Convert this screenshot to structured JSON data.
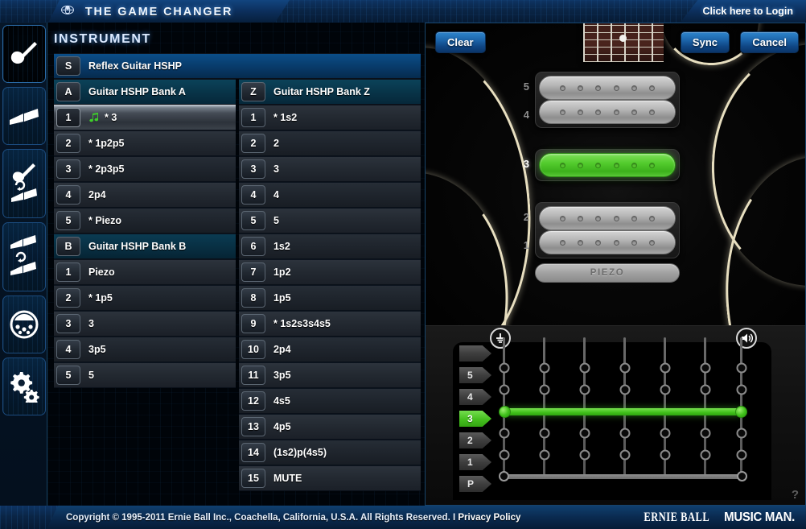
{
  "app": {
    "brand_title": "THE GAME CHANGER",
    "logo_icon": "ernie-ball-emblem-icon",
    "login_label": "Click here to Login"
  },
  "sidebar": {
    "items": [
      {
        "name": "instrument",
        "icon": "guitar-icon",
        "active": true
      },
      {
        "name": "library",
        "icon": "open-book-icon",
        "active": false
      },
      {
        "name": "guitar-to-library-sync",
        "icon": "guitar-book-sync-icon",
        "active": false
      },
      {
        "name": "library-to-library-sync",
        "icon": "book-book-sync-icon",
        "active": false
      },
      {
        "name": "midi-device",
        "icon": "midi-port-icon",
        "active": false
      },
      {
        "name": "settings",
        "icon": "gears-icon",
        "active": false
      }
    ]
  },
  "instrument_panel": {
    "title": "INSTRUMENT",
    "set_row": {
      "key": "S",
      "label": "Reflex Guitar HSHP"
    },
    "bank_a": {
      "key": "A",
      "header": "Guitar HSHP Bank A",
      "rows": [
        {
          "num": "1",
          "label": "* 3",
          "icon": "music-note-icon",
          "selected": true
        },
        {
          "num": "2",
          "label": "* 1p2p5",
          "selected": false
        },
        {
          "num": "3",
          "label": "* 2p3p5",
          "selected": false
        },
        {
          "num": "4",
          "label": "2p4",
          "selected": false
        },
        {
          "num": "5",
          "label": "* Piezo",
          "selected": false
        }
      ]
    },
    "bank_b": {
      "key": "B",
      "header": "Guitar HSHP Bank B",
      "rows": [
        {
          "num": "1",
          "label": "Piezo",
          "selected": false
        },
        {
          "num": "2",
          "label": "* 1p5",
          "selected": false
        },
        {
          "num": "3",
          "label": "3",
          "selected": false
        },
        {
          "num": "4",
          "label": "3p5",
          "selected": false
        },
        {
          "num": "5",
          "label": "5",
          "selected": false
        }
      ]
    },
    "bank_z": {
      "key": "Z",
      "header": "Guitar HSHP Bank Z",
      "rows": [
        {
          "num": "1",
          "label": "* 1s2",
          "selected": false
        },
        {
          "num": "2",
          "label": "2",
          "selected": false
        },
        {
          "num": "3",
          "label": "3",
          "selected": false
        },
        {
          "num": "4",
          "label": "4",
          "selected": false
        },
        {
          "num": "5",
          "label": "5",
          "selected": false
        },
        {
          "num": "6",
          "label": "1s2",
          "selected": false
        },
        {
          "num": "7",
          "label": "1p2",
          "selected": false
        },
        {
          "num": "8",
          "label": "1p5",
          "selected": false
        },
        {
          "num": "9",
          "label": "* 1s2s3s4s5",
          "selected": false
        },
        {
          "num": "10",
          "label": "2p4",
          "selected": false
        },
        {
          "num": "11",
          "label": "3p5",
          "selected": false
        },
        {
          "num": "12",
          "label": "4s5",
          "selected": false
        },
        {
          "num": "13",
          "label": "4p5",
          "selected": false
        },
        {
          "num": "14",
          "label": "(1s2)p(4s5)",
          "selected": false
        },
        {
          "num": "15",
          "label": "MUTE",
          "selected": false
        }
      ]
    }
  },
  "guitar_view": {
    "buttons": {
      "clear": "Clear",
      "sync": "Sync",
      "cancel": "Cancel"
    },
    "pickups": [
      {
        "num": "5",
        "active": false
      },
      {
        "num": "4",
        "active": false
      },
      {
        "num": "3",
        "active": true
      },
      {
        "num": "2",
        "active": false
      },
      {
        "num": "1",
        "active": false
      }
    ],
    "piezo_label": "PIEZO",
    "active_color": "#45bf1f",
    "inactive_color": "#b5b5b5"
  },
  "matrix": {
    "ground_icon": "ground-icon",
    "output_icon": "speaker-icon",
    "help_label": "?",
    "columns": 7,
    "rows": [
      {
        "label": "",
        "blank": true,
        "active": false
      },
      {
        "label": "5",
        "active": false
      },
      {
        "label": "4",
        "active": false
      },
      {
        "label": "3",
        "active": true
      },
      {
        "label": "2",
        "active": false
      },
      {
        "label": "1",
        "active": false
      },
      {
        "label": "P",
        "active": false
      }
    ],
    "connections": [
      {
        "row": "3",
        "from_col": 0,
        "to_col": 6,
        "color": "#3fc01a"
      },
      {
        "row": "P",
        "from_col": 0,
        "to_col": 6,
        "color": "#8e8e8e"
      }
    ]
  },
  "footer": {
    "copyright": "Copyright © 1995-2011 Ernie Ball Inc., Coachella, California, U.S.A. All Rights Reserved. I ",
    "privacy": "Privacy Policy",
    "logo_ernie_ball": "ERNIE BALL",
    "logo_music_man": "MUSIC MAN."
  }
}
